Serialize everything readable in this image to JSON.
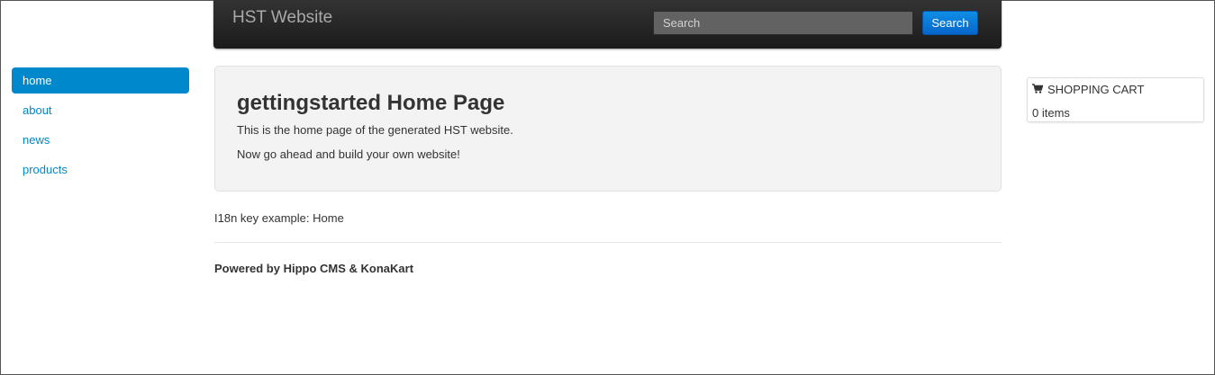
{
  "header": {
    "brand": "HST Website",
    "search_placeholder": "Search",
    "search_button": "Search"
  },
  "sidebar": {
    "items": [
      {
        "label": "home",
        "active": true
      },
      {
        "label": "about",
        "active": false
      },
      {
        "label": "news",
        "active": false
      },
      {
        "label": "products",
        "active": false
      }
    ]
  },
  "main": {
    "title": "gettingstarted Home Page",
    "intro": "This is the home page of the generated HST website.",
    "cta": "Now go ahead and build your own website!",
    "i18n_example": "I18n key example: Home"
  },
  "footer": {
    "powered_by": "Powered by Hippo CMS & KonaKart"
  },
  "cart": {
    "icon": "shopping-cart-icon",
    "title": "SHOPPING CART",
    "items_text": "0 items"
  },
  "colors": {
    "accent": "#0088cc",
    "navbar": "#222222",
    "button": "#0a72d6"
  }
}
